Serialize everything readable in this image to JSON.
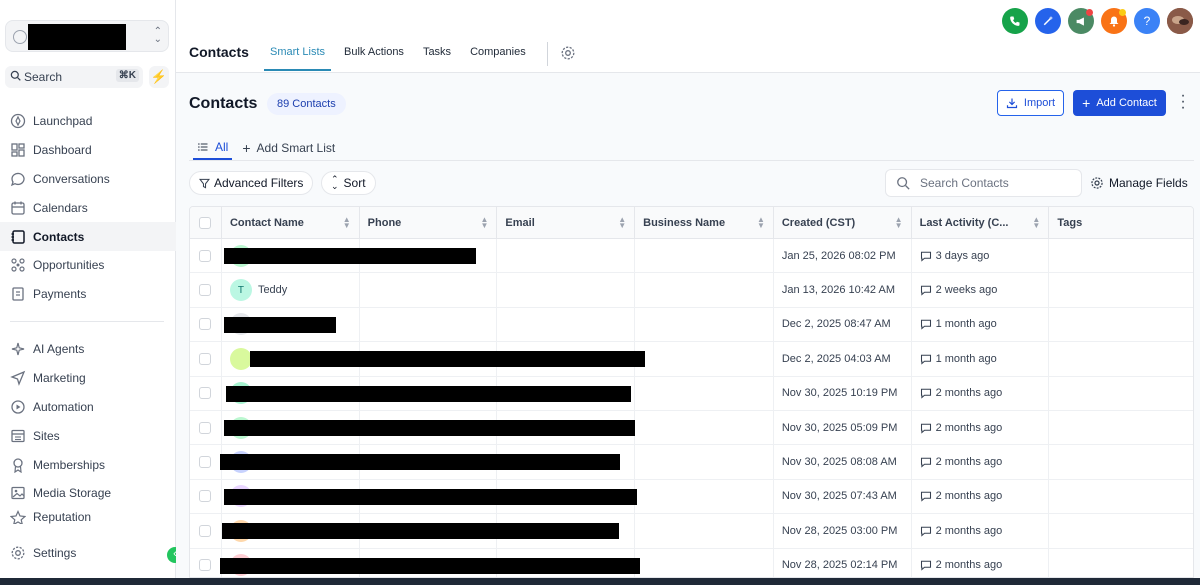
{
  "sidebar": {
    "search_label": "Search",
    "search_shortcut": "⌘K",
    "items": [
      {
        "label": "Launchpad",
        "icon": "rocket-icon"
      },
      {
        "label": "Dashboard",
        "icon": "dashboard-icon"
      },
      {
        "label": "Conversations",
        "icon": "chat-icon"
      },
      {
        "label": "Calendars",
        "icon": "calendar-icon"
      },
      {
        "label": "Contacts",
        "icon": "contacts-icon",
        "active": true
      },
      {
        "label": "Opportunities",
        "icon": "opportunities-icon"
      },
      {
        "label": "Payments",
        "icon": "payments-icon"
      }
    ],
    "items2": [
      {
        "label": "AI Agents",
        "icon": "sparkle-icon"
      },
      {
        "label": "Marketing",
        "icon": "send-icon"
      },
      {
        "label": "Automation",
        "icon": "automation-icon"
      },
      {
        "label": "Sites",
        "icon": "sites-icon"
      },
      {
        "label": "Memberships",
        "icon": "memberships-icon"
      },
      {
        "label": "Media Storage",
        "icon": "image-icon"
      },
      {
        "label": "Reputation",
        "icon": "star-icon"
      }
    ],
    "settings_label": "Settings"
  },
  "topbar": {
    "title": "Contacts",
    "tabs": [
      "Smart Lists",
      "Bulk Actions",
      "Tasks",
      "Companies"
    ],
    "active_tab": "Smart Lists",
    "icon_colors": {
      "phone": "#16a34a",
      "magic": "#2563eb",
      "megaphone": "#4b8a64",
      "bell": "#f97316",
      "help": "#3b82f6"
    }
  },
  "header": {
    "title": "Contacts",
    "count": "89 Contacts",
    "import_label": "Import",
    "add_label": "Add Contact"
  },
  "subtabs": {
    "all_label": "All",
    "add_label": "Add Smart List"
  },
  "filters": {
    "advanced_label": "Advanced Filters",
    "sort_label": "Sort",
    "search_placeholder": "Search Contacts",
    "manage_label": "Manage Fields"
  },
  "table": {
    "columns": [
      "Contact Name",
      "Phone",
      "Email",
      "Business Name",
      "Created (CST)",
      "Last Activity (C...",
      "Tags"
    ],
    "rows": [
      {
        "name": "",
        "initial": "",
        "avatar_color": "#bbf7d0",
        "created": "Jan 25, 2026 08:02 PM",
        "activity": "3 days ago"
      },
      {
        "name": "Teddy",
        "initial": "T",
        "avatar_color": "#bbf7e3",
        "created": "Jan 13, 2026 10:42 AM",
        "activity": "2 weeks ago"
      },
      {
        "name": "",
        "initial": "",
        "avatar_color": "#e5e7eb",
        "created": "Dec 2, 2025 08:47 AM",
        "activity": "1 month ago"
      },
      {
        "name": "",
        "initial": "",
        "avatar_color": "#d9f99d",
        "created": "Dec 2, 2025 04:03 AM",
        "activity": "1 month ago"
      },
      {
        "name": "",
        "initial": "",
        "avatar_color": "#a7f3d0",
        "created": "Nov 30, 2025 10:19 PM",
        "activity": "2 months ago"
      },
      {
        "name": "",
        "initial": "",
        "avatar_color": "#bbf7d0",
        "created": "Nov 30, 2025 05:09 PM",
        "activity": "2 months ago"
      },
      {
        "name": "",
        "initial": "",
        "avatar_color": "#c7d2fe",
        "created": "Nov 30, 2025 08:08 AM",
        "activity": "2 months ago"
      },
      {
        "name": "",
        "initial": "",
        "avatar_color": "#e9d5ff",
        "created": "Nov 30, 2025 07:43 AM",
        "activity": "2 months ago"
      },
      {
        "name": "",
        "initial": "",
        "avatar_color": "#fed7aa",
        "created": "Nov 28, 2025 03:00 PM",
        "activity": "2 months ago"
      },
      {
        "name": "",
        "initial": "",
        "avatar_color": "#fecdd3",
        "created": "Nov 28, 2025 02:14 PM",
        "activity": "2 months ago"
      }
    ]
  }
}
